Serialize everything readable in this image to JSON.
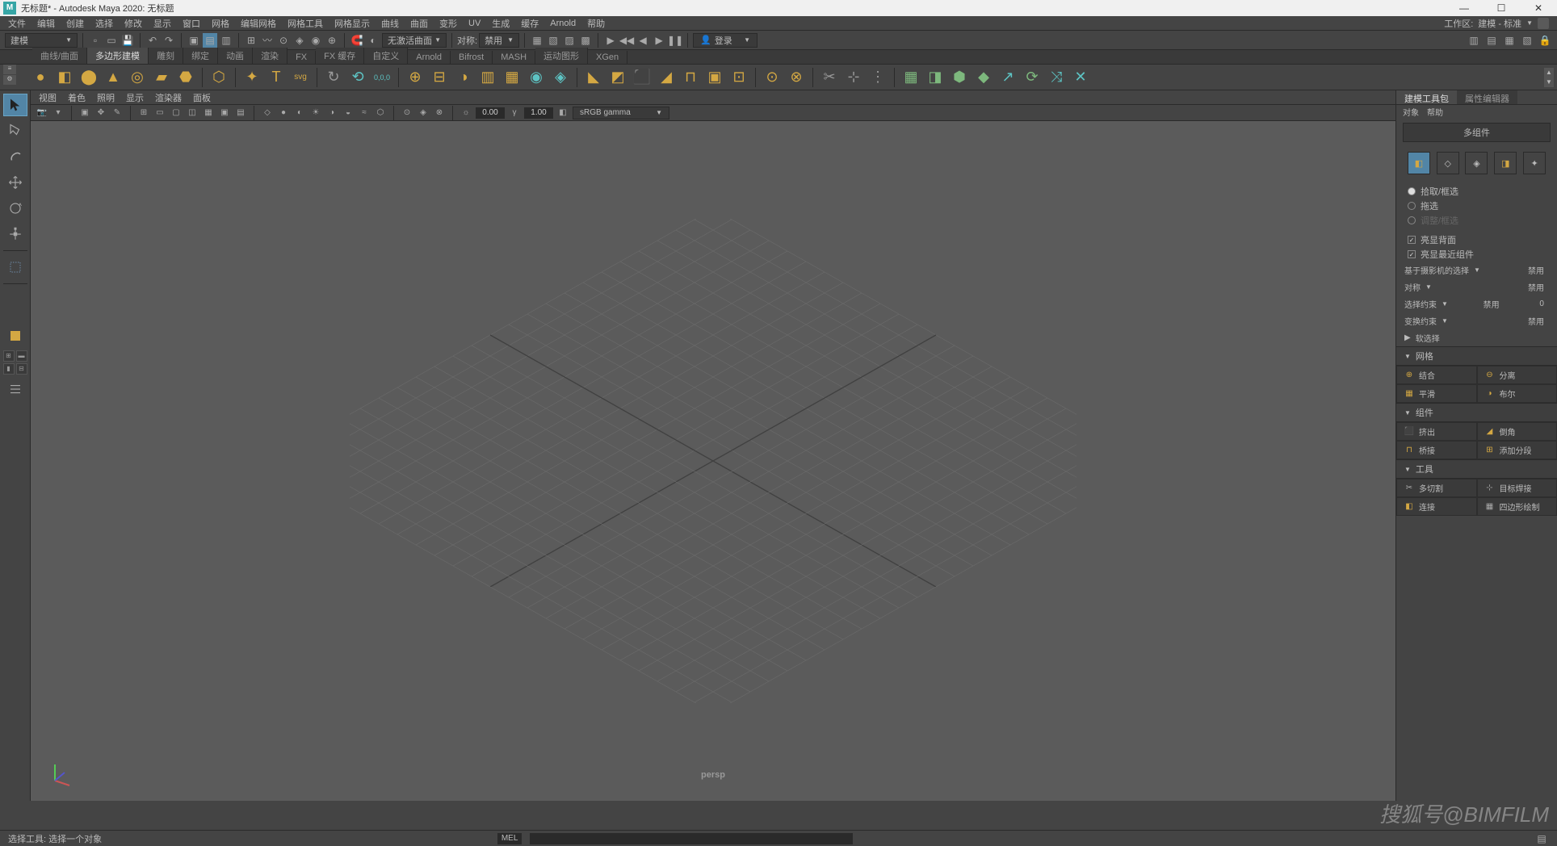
{
  "title": "无标题* - Autodesk Maya 2020: 无标题",
  "window_controls": {
    "min": "—",
    "max": "☐",
    "close": "✕"
  },
  "menubar": [
    "文件",
    "编辑",
    "创建",
    "选择",
    "修改",
    "显示",
    "窗口",
    "网格",
    "编辑网格",
    "网格工具",
    "网格显示",
    "曲线",
    "曲面",
    "变形",
    "UV",
    "生成",
    "缓存",
    "Arnold",
    "帮助"
  ],
  "workspace_label": "工作区:",
  "workspace_value": "建模 - 标准",
  "module": "建模",
  "status_line": {
    "no_active_surface": "无激活曲面",
    "sym_label": "对称:",
    "sym_value": "禁用",
    "login": "登录"
  },
  "shelf_tabs": [
    "曲线/曲面",
    "多边形建模",
    "雕刻",
    "绑定",
    "动画",
    "渲染",
    "FX",
    "FX 缓存",
    "自定义",
    "Arnold",
    "Bifrost",
    "MASH",
    "运动图形",
    "XGen"
  ],
  "shelf_active_tab": 1,
  "viewport_menus": [
    "视图",
    "着色",
    "照明",
    "显示",
    "渲染器",
    "面板"
  ],
  "viewport_nums": {
    "a": "0.00",
    "b": "1.00"
  },
  "color_mgmt": "sRGB gamma",
  "viewport_label": "persp",
  "right_panel": {
    "tabs": [
      "建模工具包",
      "属性编辑器"
    ],
    "active_tab": 0,
    "subtabs": [
      "对象",
      "帮助"
    ],
    "multi_comp": "多组件",
    "radios": [
      "拾取/框选",
      "拖选",
      "调整/框选"
    ],
    "radio_selected": 0,
    "checks": [
      "亮显背面",
      "亮显最近组件"
    ],
    "cam_sel_label": "基于摄影机的选择",
    "cam_sel_val": "禁用",
    "sym_label": "对称",
    "sym_val": "禁用",
    "sel_constraint_label": "选择约束",
    "sel_constraint_val": "禁用",
    "sel_constraint_deg": "0",
    "xform_constraint_label": "变换约束",
    "xform_constraint_val": "禁用",
    "soft_sel": "软选择",
    "sec_mesh": "网格",
    "mesh_ops": [
      "结合",
      "分离",
      "平滑",
      "布尔"
    ],
    "sec_comp": "组件",
    "comp_ops": [
      "挤出",
      "倒角",
      "桥接",
      "添加分段"
    ],
    "sec_tools": "工具",
    "tool_ops": [
      "多切割",
      "目标焊接",
      "连接",
      "四边形绘制"
    ]
  },
  "statusbar_text": "选择工具: 选择一个对象",
  "mel_label": "MEL",
  "watermark": "搜狐号@BIMFILM"
}
